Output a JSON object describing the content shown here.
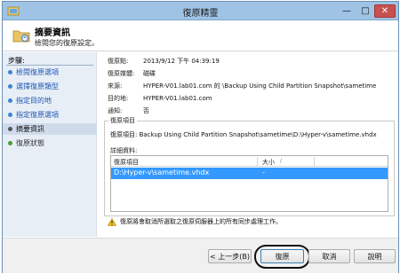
{
  "window": {
    "title": "復原精靈"
  },
  "header": {
    "title": "摘要資訊",
    "subtitle": "檢閱您的復原設定。"
  },
  "sidebar": {
    "steps_label": "步驟:",
    "items": [
      {
        "label": "檢閱復原選項",
        "state": "link"
      },
      {
        "label": "選擇復原類型",
        "state": "link"
      },
      {
        "label": "指定目的地",
        "state": "link"
      },
      {
        "label": "指定復原選項",
        "state": "link"
      },
      {
        "label": "摘要資訊",
        "state": "active"
      },
      {
        "label": "復原狀態",
        "state": "plain"
      }
    ]
  },
  "summary": {
    "recovery_point": {
      "label": "復原點:",
      "value": "2013/9/12 下午 04:39:19"
    },
    "recovery_media": {
      "label": "復原媒體:",
      "value": "磁碟"
    },
    "source": {
      "label": "來源:",
      "value": "HYPER-V01.lab01.com 的 \\Backup Using Child Partition Snapshot\\sametime"
    },
    "destination": {
      "label": "目的地:",
      "value": "HYPER-V01.lab01.com"
    },
    "notify": {
      "label": "通知:",
      "value": "否"
    }
  },
  "recovery_items": {
    "group_title": "復原項目",
    "item_label": "復原項目:",
    "item_value": "Backup Using Child Partition Snapshot\\sametime\\D:\\Hyper-v\\sametime.vhdx",
    "details_label": "詳細資料:",
    "columns": {
      "item": "復原項目",
      "size": "大小"
    },
    "rows": [
      {
        "name": "D:\\Hyper-v\\sametime.vhdx",
        "size": "-"
      }
    ]
  },
  "warning": {
    "text": "復原將會取消所選取之復原伺服器上的所有同步處理工作。"
  },
  "footer": {
    "back": "< 上一步(B)",
    "finish": "復原",
    "cancel": "取消",
    "help": "說明"
  },
  "colors": {
    "titlebar": "#9fc3e4",
    "selection": "#3399ff",
    "link": "#1f56b4",
    "sidebar": "#e7eef6"
  },
  "icons": {
    "app": "restore-app-icon",
    "header": "folder-restore-icon",
    "warning": "warning-icon",
    "close": "close-icon"
  }
}
